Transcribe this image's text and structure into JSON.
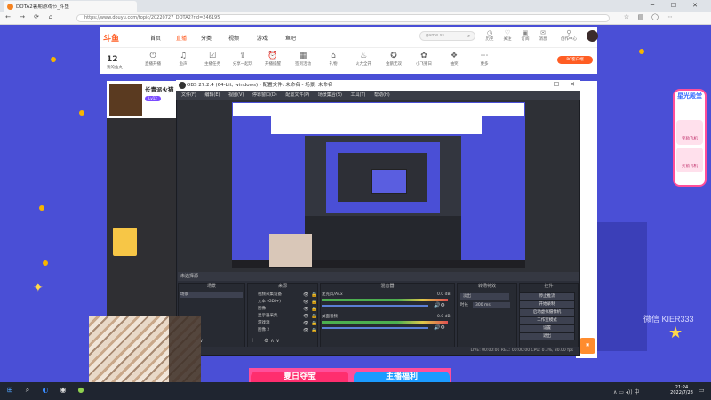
{
  "browser": {
    "tab_title": "DOTA2暑期游戏节_斗鱼",
    "url": "https://www.douyu.com/topic/20220727_DOTA2?rid=246195"
  },
  "douyu_header": {
    "logo": "斗鱼",
    "nav": [
      "首页",
      "直播",
      "分类",
      "视频",
      "游戏",
      "鱼吧"
    ],
    "search_placeholder": "game ss",
    "icons": [
      "历史",
      "关注",
      "订阅",
      "消息",
      "创作中心"
    ]
  },
  "features": {
    "fish_count": "12",
    "fish_label": "我的鱼丸",
    "items": [
      "直播开播",
      "鱼声",
      "主播任务",
      "分享一起玩",
      "开播提醒",
      "签到活动",
      "礼物",
      "火力全开",
      "金鹅无双",
      "小飞猪日",
      "抽奖",
      "更多"
    ],
    "pc_client": "PC客户端"
  },
  "streamer": {
    "name": "长青派火猫",
    "level": "Lv12"
  },
  "right_banner": {
    "title": "星光殿堂",
    "item1": "奖励飞机",
    "item2": "火箭飞机"
  },
  "wechat": "微信 KIER333",
  "bottom_banner": {
    "left": "夏日夺宝",
    "right": "主播福利"
  },
  "obs": {
    "title": "OBS 27.2.4 (64-bit, windows) - 配置文件: 未命名 - 场景: 未命名",
    "menu": [
      "文件(F)",
      "编辑(E)",
      "视图(V)",
      "停靠窗口(D)",
      "配置文件(P)",
      "场景集合(S)",
      "工具(T)",
      "帮助(H)"
    ],
    "dock_title": "未选择源",
    "dock_headers": [
      "场景",
      "来源",
      "混音器",
      "转场特效",
      "控件"
    ],
    "scene": "场景",
    "sources": [
      "视频采集设备",
      "文本 (GDI+)",
      "图像",
      "显示器采集",
      "游戏源",
      "图像 2"
    ],
    "mixer": [
      {
        "name": "麦克风/Aux",
        "db": "0.0 dB"
      },
      {
        "name": "桌面音频",
        "db": "0.0 dB"
      }
    ],
    "transition": {
      "type": "淡出",
      "duration_label": "时长",
      "duration": "300 ms"
    },
    "controls": [
      "停止推流",
      "开始录制",
      "启动虚拟摄像机",
      "工作室模式",
      "设置",
      "退出"
    ],
    "status": "LIVE: 00:00:00  REC: 00:00:00  CPU: 0.3%, 30.00 fps"
  },
  "taskbar": {
    "time": "21:24",
    "date": "2022/7/28"
  }
}
